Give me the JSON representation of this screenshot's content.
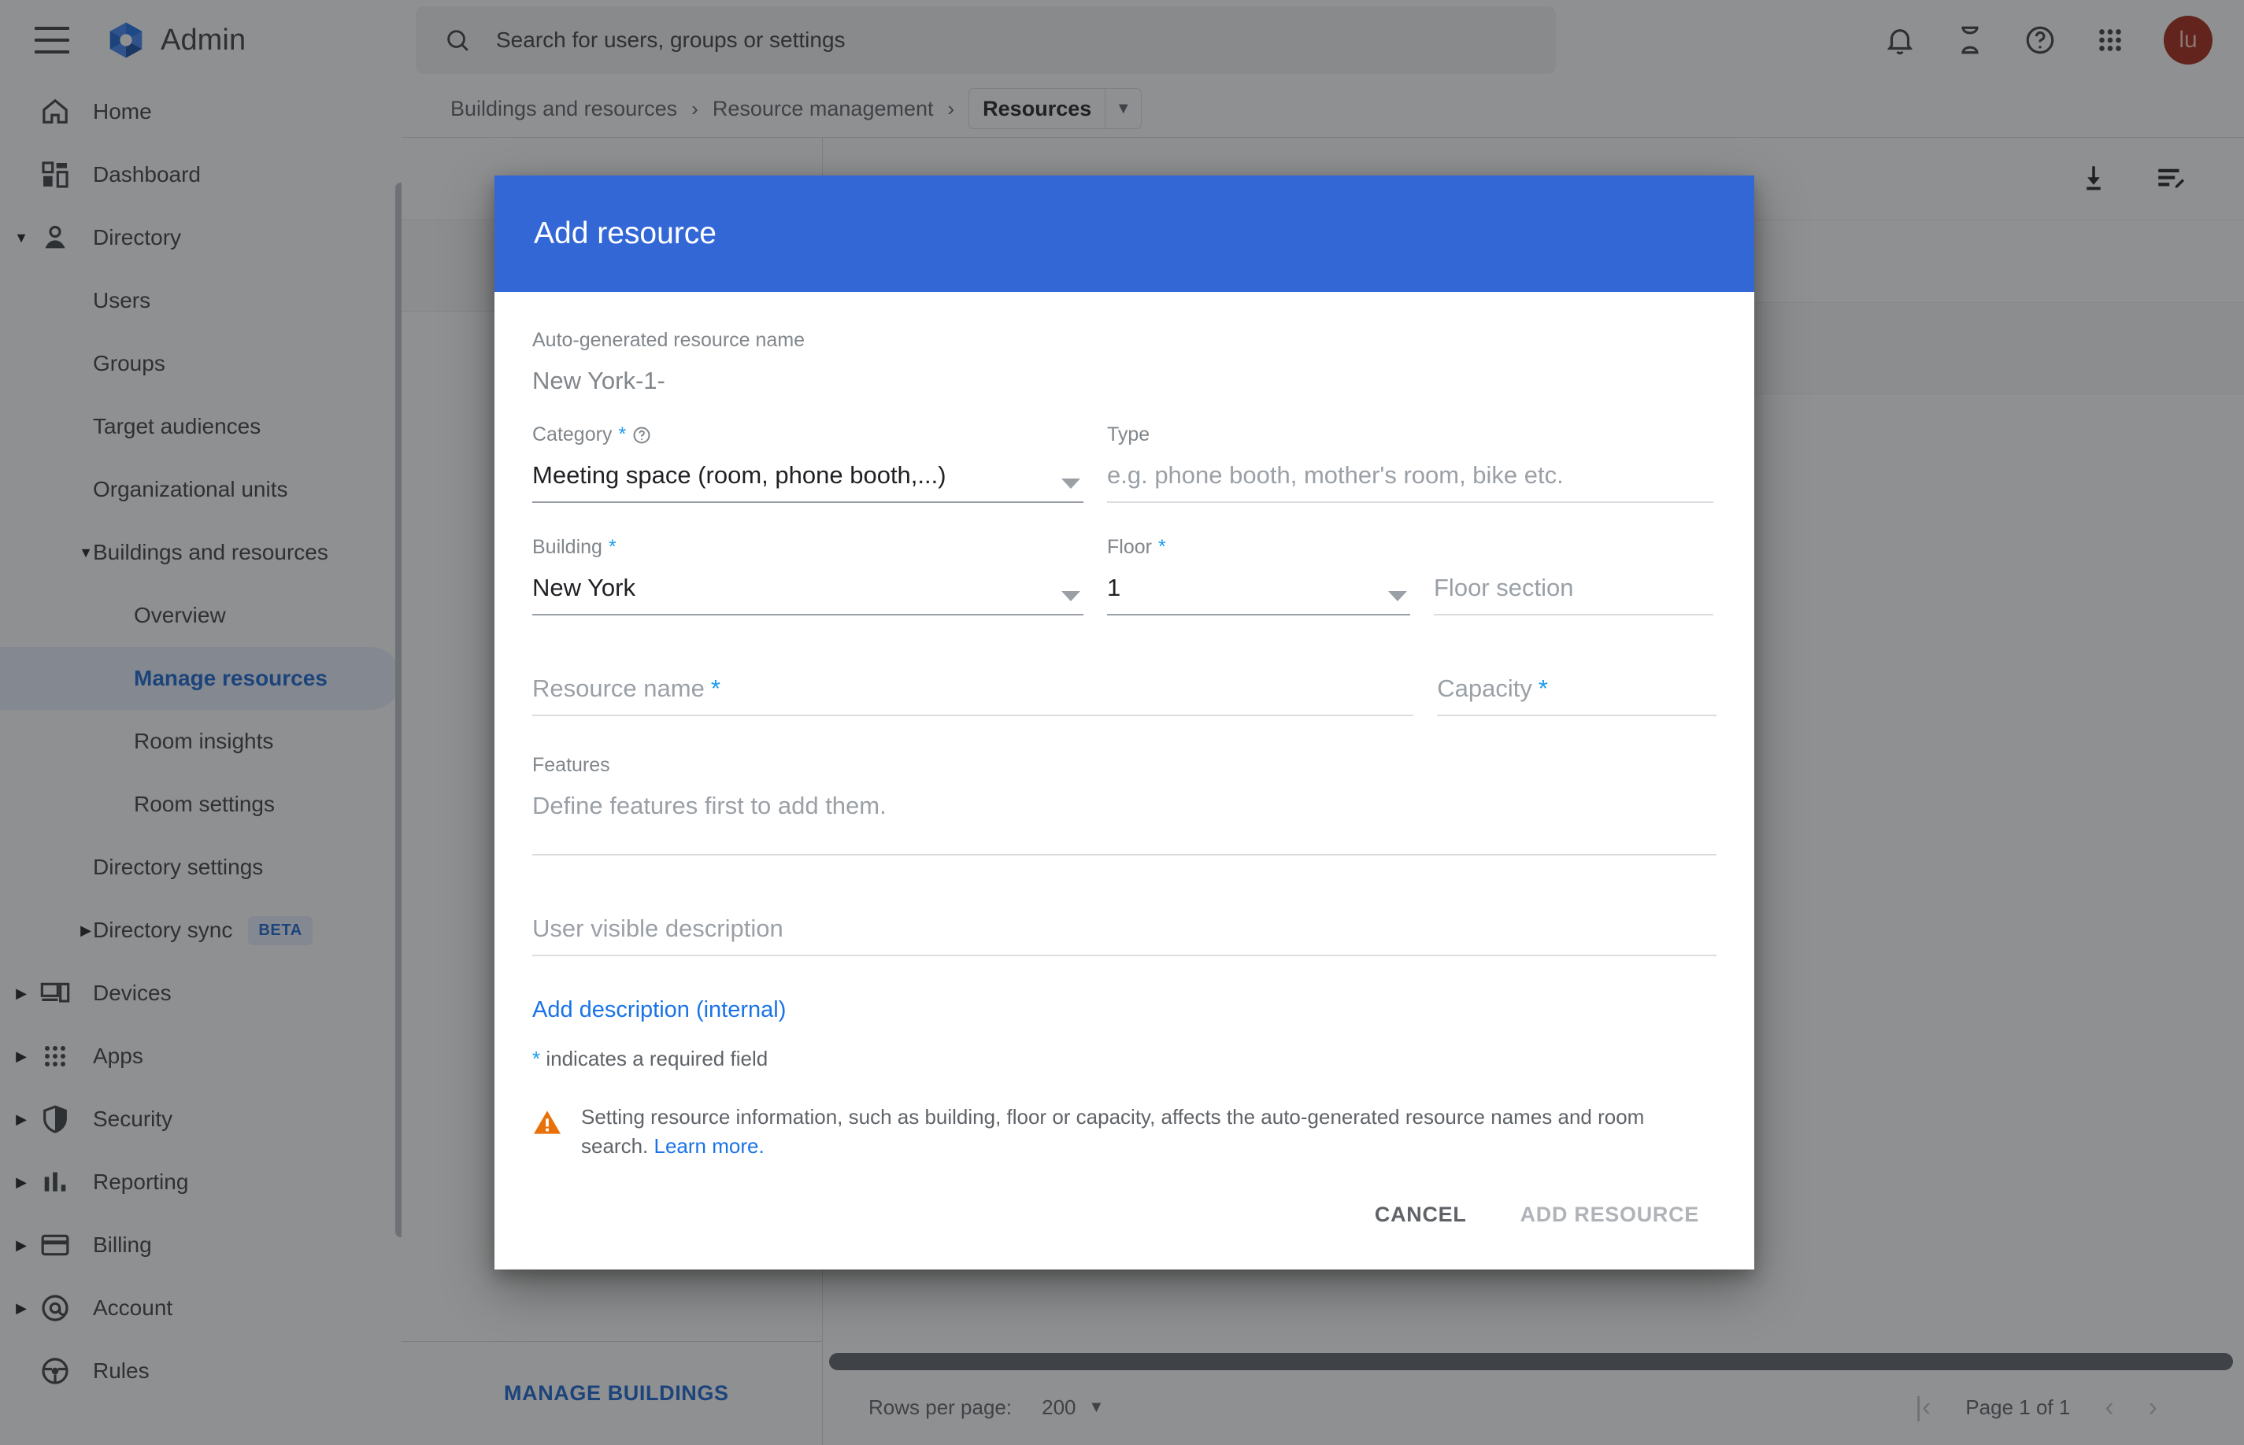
{
  "topbar": {
    "brand": "Admin",
    "menu_icon": "hamburger-icon",
    "search_placeholder": "Search for users, groups or settings",
    "icons": [
      "notifications-bell-icon",
      "hourglass-icon",
      "help-circle-icon",
      "apps-grid-icon"
    ],
    "avatar_initials": "lu"
  },
  "sidebar": {
    "items": [
      {
        "label": "Home",
        "level": 0,
        "icon": "home-icon",
        "caret": "",
        "active": false
      },
      {
        "label": "Dashboard",
        "level": 0,
        "icon": "dashboard-icon",
        "caret": "",
        "active": false
      },
      {
        "label": "Directory",
        "level": 0,
        "icon": "person-icon",
        "caret": "down",
        "active": false
      },
      {
        "label": "Users",
        "level": 1,
        "icon": "",
        "caret": "",
        "active": false
      },
      {
        "label": "Groups",
        "level": 1,
        "icon": "",
        "caret": "",
        "active": false
      },
      {
        "label": "Target audiences",
        "level": 1,
        "icon": "",
        "caret": "",
        "active": false
      },
      {
        "label": "Organizational units",
        "level": 1,
        "icon": "",
        "caret": "",
        "active": false
      },
      {
        "label": "Buildings and resources",
        "level": 1,
        "icon": "",
        "caret": "down",
        "active": false
      },
      {
        "label": "Overview",
        "level": 2,
        "icon": "",
        "caret": "",
        "active": false
      },
      {
        "label": "Manage resources",
        "level": 2,
        "icon": "",
        "caret": "",
        "active": true
      },
      {
        "label": "Room insights",
        "level": 2,
        "icon": "",
        "caret": "",
        "active": false
      },
      {
        "label": "Room settings",
        "level": 2,
        "icon": "",
        "caret": "",
        "active": false
      },
      {
        "label": "Directory settings",
        "level": 1,
        "icon": "",
        "caret": "",
        "active": false
      },
      {
        "label": "Directory sync",
        "level": 1,
        "icon": "",
        "caret": "right",
        "active": false,
        "badge": "BETA"
      },
      {
        "label": "Devices",
        "level": 0,
        "icon": "devices-icon",
        "caret": "right",
        "active": false
      },
      {
        "label": "Apps",
        "level": 0,
        "icon": "apps-grid-icon",
        "caret": "right",
        "active": false
      },
      {
        "label": "Security",
        "level": 0,
        "icon": "shield-icon",
        "caret": "right",
        "active": false
      },
      {
        "label": "Reporting",
        "level": 0,
        "icon": "bar-chart-icon",
        "caret": "right",
        "active": false
      },
      {
        "label": "Billing",
        "level": 0,
        "icon": "credit-card-icon",
        "caret": "right",
        "active": false
      },
      {
        "label": "Account",
        "level": 0,
        "icon": "at-sign-icon",
        "caret": "right",
        "active": false
      },
      {
        "label": "Rules",
        "level": 0,
        "icon": "steering-wheel-icon",
        "caret": "",
        "active": false
      }
    ]
  },
  "breadcrumb": {
    "crumb1": "Buildings and resources",
    "sep": "›",
    "crumb2": "Resource management",
    "chip": "Resources",
    "chip_caret_icon": "chevron-down-icon"
  },
  "toolbar": {
    "download_icon": "download-icon",
    "edit_list_icon": "list-edit-icon"
  },
  "left_pane": {
    "manage_buildings": "MANAGE BUILDINGS"
  },
  "footer": {
    "rows_per_page_label": "Rows per page:",
    "rows_per_page_value": "200",
    "rows_caret_icon": "chevron-down-icon",
    "first_page_icon": "first-page-icon",
    "prev_page_icon": "chevron-left-icon",
    "page_text": "Page 1 of 1",
    "next_page_icon": "chevron-right-icon"
  },
  "dialog": {
    "title": "Add resource",
    "autogen_caption": "Auto-generated resource name",
    "autogen_value": "New York-1-",
    "category": {
      "label": "Category",
      "required_mark": "*",
      "help_icon": "help-circle-icon",
      "value": "Meeting space (room, phone booth,...)",
      "caret_icon": "chevron-down-icon"
    },
    "type": {
      "label": "Type",
      "placeholder": "e.g. phone booth, mother's room, bike etc."
    },
    "building": {
      "label": "Building",
      "required_mark": "*",
      "value": "New York",
      "caret_icon": "chevron-down-icon"
    },
    "floor": {
      "label": "Floor",
      "required_mark": "*",
      "value": "1",
      "caret_icon": "chevron-down-icon"
    },
    "floor_section": {
      "placeholder": "Floor section"
    },
    "resource_name": {
      "placeholder": "Resource name",
      "required_mark": "*"
    },
    "capacity": {
      "placeholder": "Capacity",
      "required_mark": "*"
    },
    "features": {
      "label": "Features",
      "placeholder": "Define features first to add them."
    },
    "user_visible_description": {
      "placeholder": "User visible description"
    },
    "add_description_link": "Add description (internal)",
    "required_note_mark": "*",
    "required_note": " indicates a required field",
    "warning": {
      "icon": "warning-triangle-icon",
      "text": "Setting resource information, such as building, floor or capacity, affects the auto-generated resource names and room search. ",
      "link": "Learn more."
    },
    "cancel_label": "CANCEL",
    "submit_label": "ADD RESOURCE"
  },
  "colors": {
    "dialog_header": "#3367d6",
    "link": "#1a73e8",
    "active_nav": "#1967d2",
    "required_star": "#1a9cf0",
    "warning": "#e8710a",
    "avatar": "#a52714"
  }
}
